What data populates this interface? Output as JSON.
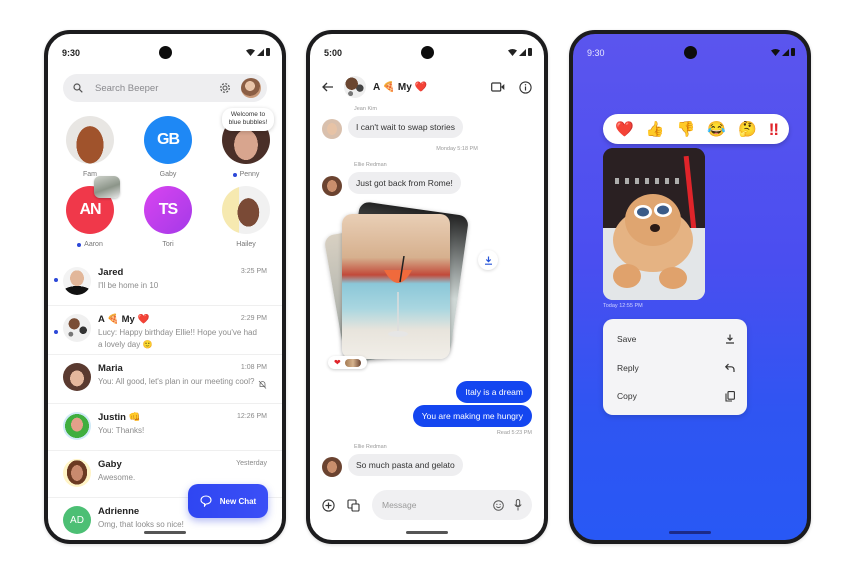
{
  "phone1": {
    "status_time": "9:30",
    "search": {
      "placeholder": "Search Beeper"
    },
    "tooltip": "Welcome to blue bubbles!",
    "pinned": [
      {
        "name": "Fam",
        "initials": "",
        "color": "#e8e6e3",
        "unread": false
      },
      {
        "name": "Gaby",
        "initials": "GB",
        "color": "#1e88f5",
        "unread": false
      },
      {
        "name": "Penny",
        "initials": "",
        "color": "#5a3a32",
        "unread": true
      },
      {
        "name": "Aaron",
        "initials": "AN",
        "color": "#f0384a",
        "unread": true
      },
      {
        "name": "Tori",
        "initials": "TS",
        "color": "#c63ef0",
        "unread": false
      },
      {
        "name": "Hailey",
        "initials": "",
        "color": "#f1e8c6",
        "unread": false
      }
    ],
    "chats": [
      {
        "name": "Jared",
        "preview": "I'll be home in 10",
        "time": "3:25 PM",
        "unread": true,
        "muted": false
      },
      {
        "name": "A 🍕 My ❤️",
        "preview": "Lucy: Happy birthday Ellie!! Hope you've had a lovely day 🙂",
        "time": "2:29 PM",
        "unread": true,
        "muted": false
      },
      {
        "name": "Maria",
        "preview": "You: All good, let's plan in our meeting cool?",
        "time": "1:08 PM",
        "unread": false,
        "muted": true
      },
      {
        "name": "Justin 👊",
        "preview": "You: Thanks!",
        "time": "12:26 PM",
        "unread": false,
        "muted": false
      },
      {
        "name": "Gaby",
        "preview": "Awesome.",
        "time": "Yesterday",
        "unread": false,
        "muted": false
      },
      {
        "name": "Adrienne",
        "preview": "Omg, that looks so nice!",
        "time": "",
        "unread": false,
        "muted": false,
        "initials": "AD"
      }
    ],
    "fab_label": "New Chat"
  },
  "phone2": {
    "status_time": "5:00",
    "chat_title": "A 🍕 My ❤️",
    "messages": [
      {
        "sender": "Jean Kim",
        "text": "I can't wait to swap stories",
        "direction": "in"
      },
      {
        "separator": "Monday 5:18 PM"
      },
      {
        "sender": "Ellie Redman",
        "text": "Just got back from Rome!",
        "direction": "in"
      },
      {
        "attachment": "photo-stack",
        "reactions": "❤️ 2"
      },
      {
        "text": "Italy is a dream",
        "direction": "out"
      },
      {
        "text": "You are making me hungry",
        "direction": "out"
      },
      {
        "receipt": "Read  5:23 PM"
      },
      {
        "sender": "Ellie Redman",
        "text": "So much pasta and gelato",
        "direction": "in"
      }
    ],
    "composer": {
      "placeholder": "Message"
    }
  },
  "phone3": {
    "status_time": "9:30",
    "reactions": [
      "❤️",
      "👍",
      "👎",
      "😂",
      "🤔",
      "‼"
    ],
    "photo_time": "Today  12:55 PM",
    "menu": [
      {
        "label": "Save",
        "icon": "download-icon"
      },
      {
        "label": "Reply",
        "icon": "reply-icon"
      },
      {
        "label": "Copy",
        "icon": "copy-icon"
      }
    ]
  },
  "colors": {
    "accent_blue": "#1446f0",
    "unread_dot": "#2c48d8",
    "fab": "#3049f3",
    "bg_purple": "#5b55ee"
  }
}
